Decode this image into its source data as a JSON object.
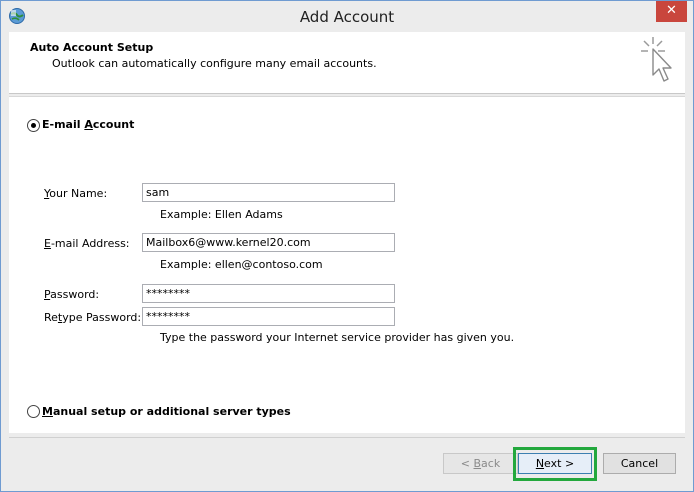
{
  "window": {
    "title": "Add Account"
  },
  "header": {
    "title": "Auto Account Setup",
    "subtitle": "Outlook can automatically configure many email accounts."
  },
  "email_account": {
    "label_pre": "E-mail ",
    "label_hot": "A",
    "label_post": "ccount",
    "selected": true,
    "fields": {
      "name": {
        "label_hot": "Y",
        "label_rest": "our Name:",
        "value": "sam",
        "hint": "Example: Ellen Adams"
      },
      "email": {
        "label_hot": "E",
        "label_rest": "-mail Address:",
        "value": "Mailbox6@www.kernel20.com",
        "hint": "Example: ellen@contoso.com"
      },
      "password": {
        "label_hot": "P",
        "label_rest": "assword:",
        "value": "********"
      },
      "retype": {
        "label_pre": "Re",
        "label_hot": "t",
        "label_rest": "ype Password:",
        "value": "********",
        "hint": "Type the password your Internet service provider has given you."
      }
    }
  },
  "manual_setup": {
    "label_hot": "M",
    "label_rest": "anual setup or additional server types",
    "selected": false
  },
  "buttons": {
    "back": {
      "label_pre": "< ",
      "label_hot": "B",
      "label_rest": "ack",
      "enabled": false
    },
    "next": {
      "label_hot": "N",
      "label_rest": "ext >",
      "enabled": true
    },
    "cancel": {
      "label": "Cancel"
    }
  },
  "colors": {
    "highlight": "#23a83d",
    "close": "#c9463d"
  },
  "icons": {
    "app": "outlook-globe-icon",
    "wizard": "sparkle-cursor-icon",
    "close": "close-icon"
  }
}
